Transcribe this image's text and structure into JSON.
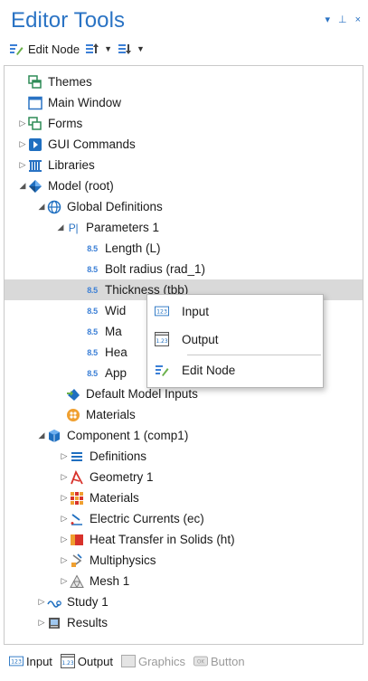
{
  "window": {
    "title": "Editor Tools",
    "controls": [
      "▾",
      "⊥",
      "×"
    ]
  },
  "toolbar": {
    "edit_node_label": "Edit Node"
  },
  "tree": {
    "themes": "Themes",
    "main_window": "Main Window",
    "forms": "Forms",
    "gui_commands": "GUI Commands",
    "libraries": "Libraries",
    "model": "Model (root)",
    "global_definitions": "Global Definitions",
    "parameters": "Parameters 1",
    "param_badge": "8.5",
    "pi_badge": "P|",
    "param_length": "Length (L)",
    "param_bolt": "Bolt radius (rad_1)",
    "param_thickness": "Thickness (tbb)",
    "param_wid": "Wid",
    "param_ma": "Ma",
    "param_hea": "Hea",
    "param_app": "App",
    "default_inputs": "Default Model Inputs",
    "materials_global": "Materials",
    "component": "Component 1 (comp1)",
    "definitions": "Definitions",
    "geometry": "Geometry 1",
    "materials": "Materials",
    "electric_currents": "Electric Currents (ec)",
    "heat_transfer": "Heat Transfer in Solids (ht)",
    "multiphysics": "Multiphysics",
    "mesh": "Mesh 1",
    "study": "Study 1",
    "results": "Results"
  },
  "context_menu": {
    "input": "Input",
    "output": "Output",
    "edit_node": "Edit Node"
  },
  "bottom_bar": {
    "input": "Input",
    "output": "Output",
    "graphics": "Graphics",
    "button": "Button"
  },
  "colors": {
    "accent": "#2a73c4",
    "selection": "#d9d9d9"
  }
}
